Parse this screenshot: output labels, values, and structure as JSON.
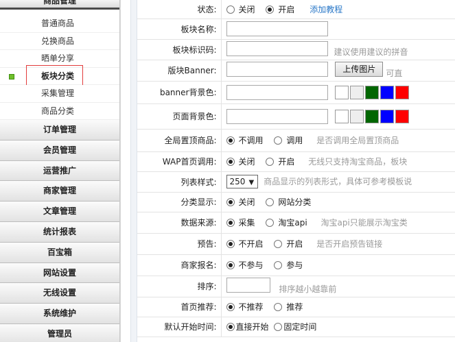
{
  "sidebar": {
    "top_header": "商品管理",
    "sub_items": [
      "普通商品",
      "兑换商品",
      "晒单分享",
      "板块分类",
      "采集管理",
      "商品分类"
    ],
    "categories": [
      "订单管理",
      "会员管理",
      "运营推广",
      "商家管理",
      "文章管理",
      "统计报表",
      "百宝箱",
      "网站设置",
      "无线设置",
      "系统维护",
      "管理员"
    ]
  },
  "form": {
    "status": {
      "label": "状态:",
      "opt_close": "关闭",
      "opt_open": "开启",
      "link": "添加教程"
    },
    "name": {
      "label": "板块名称:"
    },
    "code": {
      "label": "板块标识码:",
      "hint": "建议使用建议的拼音"
    },
    "banner": {
      "label": "版块Banner:",
      "upload": "上传图片",
      "hint": "可直"
    },
    "banner_bg": {
      "label": "banner背景色:"
    },
    "page_bg": {
      "label": "页面背景色:"
    },
    "global_top": {
      "label": "全局置顶商品:",
      "opt_no": "不调用",
      "opt_yes": "调用",
      "hint": "是否调用全局置顶商品"
    },
    "wap_home": {
      "label": "WAP首页调用:",
      "opt_close": "关闭",
      "opt_open": "开启",
      "hint": "无线只支持淘宝商品，板块"
    },
    "list_style": {
      "label": "列表样式:",
      "value": "250",
      "hint": "商品显示的列表形式，具体可参考模板说"
    },
    "cat_display": {
      "label": "分类显示:",
      "opt_close": "关闭",
      "opt_site": "网站分类"
    },
    "source": {
      "label": "数据来源:",
      "opt_collect": "采集",
      "opt_taobao": "淘宝api",
      "hint": "淘宝api只能展示淘宝类"
    },
    "preview": {
      "label": "预告:",
      "opt_off": "不开启",
      "opt_on": "开启",
      "hint": "是否开启预告链接"
    },
    "merchant": {
      "label": "商家报名:",
      "opt_no": "不参与",
      "opt_yes": "参与"
    },
    "sort": {
      "label": "排序:",
      "hint": "排序越小越靠前"
    },
    "home_rec": {
      "label": "首页推荐:",
      "opt_no": "不推荐",
      "opt_yes": "推荐"
    },
    "start_time": {
      "label": "默认开始时间:",
      "opt_direct": "直接开始",
      "opt_fixed": "固定时间"
    }
  },
  "colors": {
    "swatches": [
      "#ffffff",
      "#eeeeee",
      "#006600",
      "#0000ff",
      "#ff0000"
    ]
  }
}
